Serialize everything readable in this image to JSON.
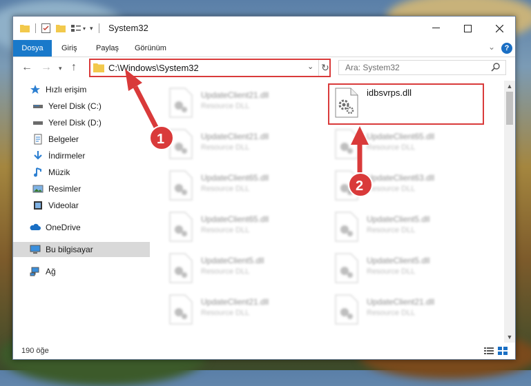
{
  "window": {
    "title": "System32"
  },
  "ribbon": {
    "tabs": [
      "Dosya",
      "Giriş",
      "Paylaş",
      "Görünüm"
    ]
  },
  "address": {
    "path": "C:\\Windows\\System32"
  },
  "search": {
    "placeholder": "Ara: System32"
  },
  "nav": {
    "items": [
      {
        "label": "Hızlı erişim",
        "icon": "star-icon",
        "pinned": false
      },
      {
        "label": "Yerel Disk (C:)",
        "icon": "drive-icon",
        "pinned": true
      },
      {
        "label": "Yerel Disk (D:)",
        "icon": "drive-icon",
        "pinned": true
      },
      {
        "label": "Belgeler",
        "icon": "document-icon",
        "pinned": true
      },
      {
        "label": "İndirmeler",
        "icon": "download-icon",
        "pinned": true
      },
      {
        "label": "Müzik",
        "icon": "music-icon",
        "pinned": true
      },
      {
        "label": "Resimler",
        "icon": "pictures-icon",
        "pinned": true
      },
      {
        "label": "Videolar",
        "icon": "video-icon",
        "pinned": true
      },
      {
        "label": "OneDrive",
        "icon": "cloud-icon",
        "pinned": false
      },
      {
        "label": "Bu bilgisayar",
        "icon": "computer-icon",
        "pinned": false,
        "selected": true
      },
      {
        "label": "Ağ",
        "icon": "network-icon",
        "pinned": false
      }
    ]
  },
  "files": {
    "highlighted": {
      "name": "idbsvrps.dll"
    },
    "left_column": [
      {
        "name": "UpdateClient21.dll",
        "type": "Resource DLL"
      },
      {
        "name": "UpdateClient21.dll",
        "type": "Resource DLL"
      },
      {
        "name": "UpdateClient65.dll",
        "type": "Resource DLL"
      },
      {
        "name": "UpdateClient65.dll",
        "type": "Resource DLL"
      },
      {
        "name": "UpdateClient5.dll",
        "type": "Resource DLL"
      },
      {
        "name": "UpdateClient21.dll",
        "type": "Resource DLL"
      }
    ],
    "right_column": [
      {
        "name": "UpdateClient65.dll",
        "type": "Resource DLL"
      },
      {
        "name": "UpdateClient63.dll",
        "type": "Resource DLL"
      },
      {
        "name": "UpdateClient5.dll",
        "type": "Resource DLL"
      },
      {
        "name": "UpdateClient5.dll",
        "type": "Resource DLL"
      },
      {
        "name": "UpdateClient21.dll",
        "type": "Resource DLL"
      }
    ]
  },
  "status": {
    "item_count": "190 öğe"
  },
  "annotations": {
    "badge_1": "1",
    "badge_2": "2"
  },
  "colors": {
    "accent": "#1979ca",
    "highlight": "#d93a3a"
  }
}
